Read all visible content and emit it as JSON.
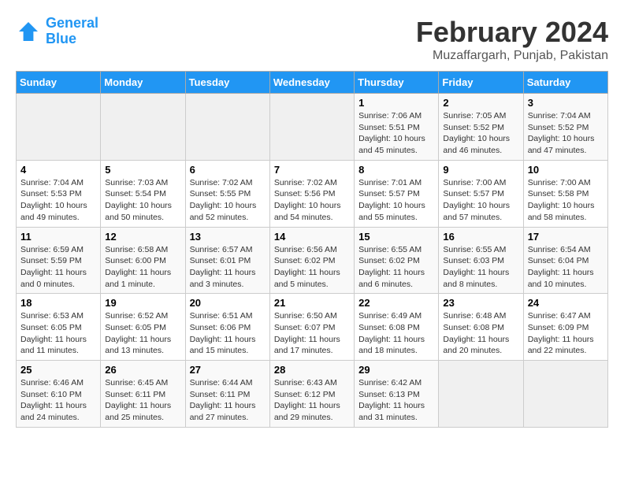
{
  "header": {
    "logo_text_general": "General",
    "logo_text_blue": "Blue",
    "main_title": "February 2024",
    "subtitle": "Muzaffargarh, Punjab, Pakistan"
  },
  "calendar": {
    "days_of_week": [
      "Sunday",
      "Monday",
      "Tuesday",
      "Wednesday",
      "Thursday",
      "Friday",
      "Saturday"
    ],
    "weeks": [
      [
        {
          "day": "",
          "info": ""
        },
        {
          "day": "",
          "info": ""
        },
        {
          "day": "",
          "info": ""
        },
        {
          "day": "",
          "info": ""
        },
        {
          "day": "1",
          "info": "Sunrise: 7:06 AM\nSunset: 5:51 PM\nDaylight: 10 hours\nand 45 minutes."
        },
        {
          "day": "2",
          "info": "Sunrise: 7:05 AM\nSunset: 5:52 PM\nDaylight: 10 hours\nand 46 minutes."
        },
        {
          "day": "3",
          "info": "Sunrise: 7:04 AM\nSunset: 5:52 PM\nDaylight: 10 hours\nand 47 minutes."
        }
      ],
      [
        {
          "day": "4",
          "info": "Sunrise: 7:04 AM\nSunset: 5:53 PM\nDaylight: 10 hours\nand 49 minutes."
        },
        {
          "day": "5",
          "info": "Sunrise: 7:03 AM\nSunset: 5:54 PM\nDaylight: 10 hours\nand 50 minutes."
        },
        {
          "day": "6",
          "info": "Sunrise: 7:02 AM\nSunset: 5:55 PM\nDaylight: 10 hours\nand 52 minutes."
        },
        {
          "day": "7",
          "info": "Sunrise: 7:02 AM\nSunset: 5:56 PM\nDaylight: 10 hours\nand 54 minutes."
        },
        {
          "day": "8",
          "info": "Sunrise: 7:01 AM\nSunset: 5:57 PM\nDaylight: 10 hours\nand 55 minutes."
        },
        {
          "day": "9",
          "info": "Sunrise: 7:00 AM\nSunset: 5:57 PM\nDaylight: 10 hours\nand 57 minutes."
        },
        {
          "day": "10",
          "info": "Sunrise: 7:00 AM\nSunset: 5:58 PM\nDaylight: 10 hours\nand 58 minutes."
        }
      ],
      [
        {
          "day": "11",
          "info": "Sunrise: 6:59 AM\nSunset: 5:59 PM\nDaylight: 11 hours\nand 0 minutes."
        },
        {
          "day": "12",
          "info": "Sunrise: 6:58 AM\nSunset: 6:00 PM\nDaylight: 11 hours\nand 1 minute."
        },
        {
          "day": "13",
          "info": "Sunrise: 6:57 AM\nSunset: 6:01 PM\nDaylight: 11 hours\nand 3 minutes."
        },
        {
          "day": "14",
          "info": "Sunrise: 6:56 AM\nSunset: 6:02 PM\nDaylight: 11 hours\nand 5 minutes."
        },
        {
          "day": "15",
          "info": "Sunrise: 6:55 AM\nSunset: 6:02 PM\nDaylight: 11 hours\nand 6 minutes."
        },
        {
          "day": "16",
          "info": "Sunrise: 6:55 AM\nSunset: 6:03 PM\nDaylight: 11 hours\nand 8 minutes."
        },
        {
          "day": "17",
          "info": "Sunrise: 6:54 AM\nSunset: 6:04 PM\nDaylight: 11 hours\nand 10 minutes."
        }
      ],
      [
        {
          "day": "18",
          "info": "Sunrise: 6:53 AM\nSunset: 6:05 PM\nDaylight: 11 hours\nand 11 minutes."
        },
        {
          "day": "19",
          "info": "Sunrise: 6:52 AM\nSunset: 6:05 PM\nDaylight: 11 hours\nand 13 minutes."
        },
        {
          "day": "20",
          "info": "Sunrise: 6:51 AM\nSunset: 6:06 PM\nDaylight: 11 hours\nand 15 minutes."
        },
        {
          "day": "21",
          "info": "Sunrise: 6:50 AM\nSunset: 6:07 PM\nDaylight: 11 hours\nand 17 minutes."
        },
        {
          "day": "22",
          "info": "Sunrise: 6:49 AM\nSunset: 6:08 PM\nDaylight: 11 hours\nand 18 minutes."
        },
        {
          "day": "23",
          "info": "Sunrise: 6:48 AM\nSunset: 6:08 PM\nDaylight: 11 hours\nand 20 minutes."
        },
        {
          "day": "24",
          "info": "Sunrise: 6:47 AM\nSunset: 6:09 PM\nDaylight: 11 hours\nand 22 minutes."
        }
      ],
      [
        {
          "day": "25",
          "info": "Sunrise: 6:46 AM\nSunset: 6:10 PM\nDaylight: 11 hours\nand 24 minutes."
        },
        {
          "day": "26",
          "info": "Sunrise: 6:45 AM\nSunset: 6:11 PM\nDaylight: 11 hours\nand 25 minutes."
        },
        {
          "day": "27",
          "info": "Sunrise: 6:44 AM\nSunset: 6:11 PM\nDaylight: 11 hours\nand 27 minutes."
        },
        {
          "day": "28",
          "info": "Sunrise: 6:43 AM\nSunset: 6:12 PM\nDaylight: 11 hours\nand 29 minutes."
        },
        {
          "day": "29",
          "info": "Sunrise: 6:42 AM\nSunset: 6:13 PM\nDaylight: 11 hours\nand 31 minutes."
        },
        {
          "day": "",
          "info": ""
        },
        {
          "day": "",
          "info": ""
        }
      ]
    ]
  }
}
